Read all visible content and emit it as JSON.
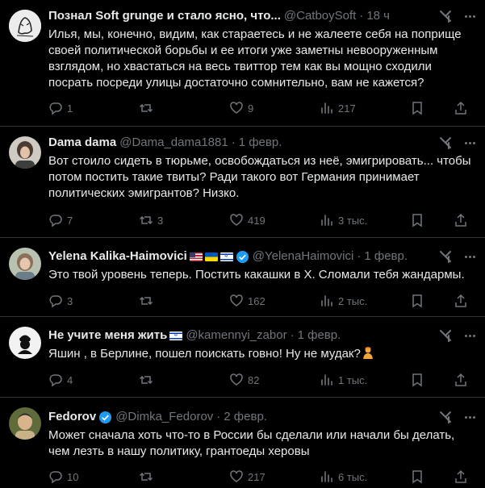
{
  "tweets": [
    {
      "name": "Познал Soft grunge и стало ясно, что...",
      "handle": "@CatboySoft",
      "time": "18 ч",
      "text": "Илья, мы, конечно, видим, как стараетесь и не жалеете себя на поприще своей политической борьбы и ее итоги уже заметны невооруженным взглядом, но хвастаться на весь твиттор тем как вы мощно сходили посрать посреди улицы достаточно сомнительно, вам не кажется?",
      "replies": "1",
      "retweets": "",
      "likes": "9",
      "views": "217"
    },
    {
      "name": "Dama dama",
      "handle": "@Dama_dama1881",
      "time": "1 февр.",
      "text": "Вот стоило сидеть в тюрьме, освобождаться из неё, эмигрировать... чтобы потом постить такие твиты? Ради такого вот Германия принимает политических эмигрантов? Низко.",
      "replies": "7",
      "retweets": "3",
      "likes": "419",
      "views": "3 тыс."
    },
    {
      "name": "Yelena Kalika-Haimovici",
      "handle": "@YelenaHaimovici",
      "time": "1 февр.",
      "text": "Это твой уровень теперь. Постить какашки в Х. Сломали тебя жандармы.",
      "replies": "3",
      "retweets": "",
      "likes": "162",
      "views": "2 тыс."
    },
    {
      "name": "Не учите меня жить",
      "handle": "@kamennyi_zabor",
      "time": "1 февр.",
      "text": "Яшин , в Берлине, пошел поискать говно! Ну не мудак?",
      "replies": "4",
      "retweets": "",
      "likes": "82",
      "views": "1 тыс."
    },
    {
      "name": "Fedorov",
      "handle": "@Dimka_Fedorov",
      "time": "2 февр.",
      "text": "Может сначала хоть что-то в России бы сделали или начали бы делать, чем лезть в нашу политику, грантоеды херовы",
      "replies": "10",
      "retweets": "",
      "likes": "217",
      "views": "6 тыс."
    }
  ],
  "colors": {
    "background": "#000000",
    "text": "#e7e9ea",
    "muted": "#71767b",
    "divider": "#2f3336",
    "verified": "#1d9bf0"
  },
  "icons": [
    "reply-icon",
    "retweet-icon",
    "like-icon",
    "views-icon",
    "bookmark-icon",
    "share-icon",
    "grok-icon",
    "more-icon",
    "verified-icon"
  ]
}
